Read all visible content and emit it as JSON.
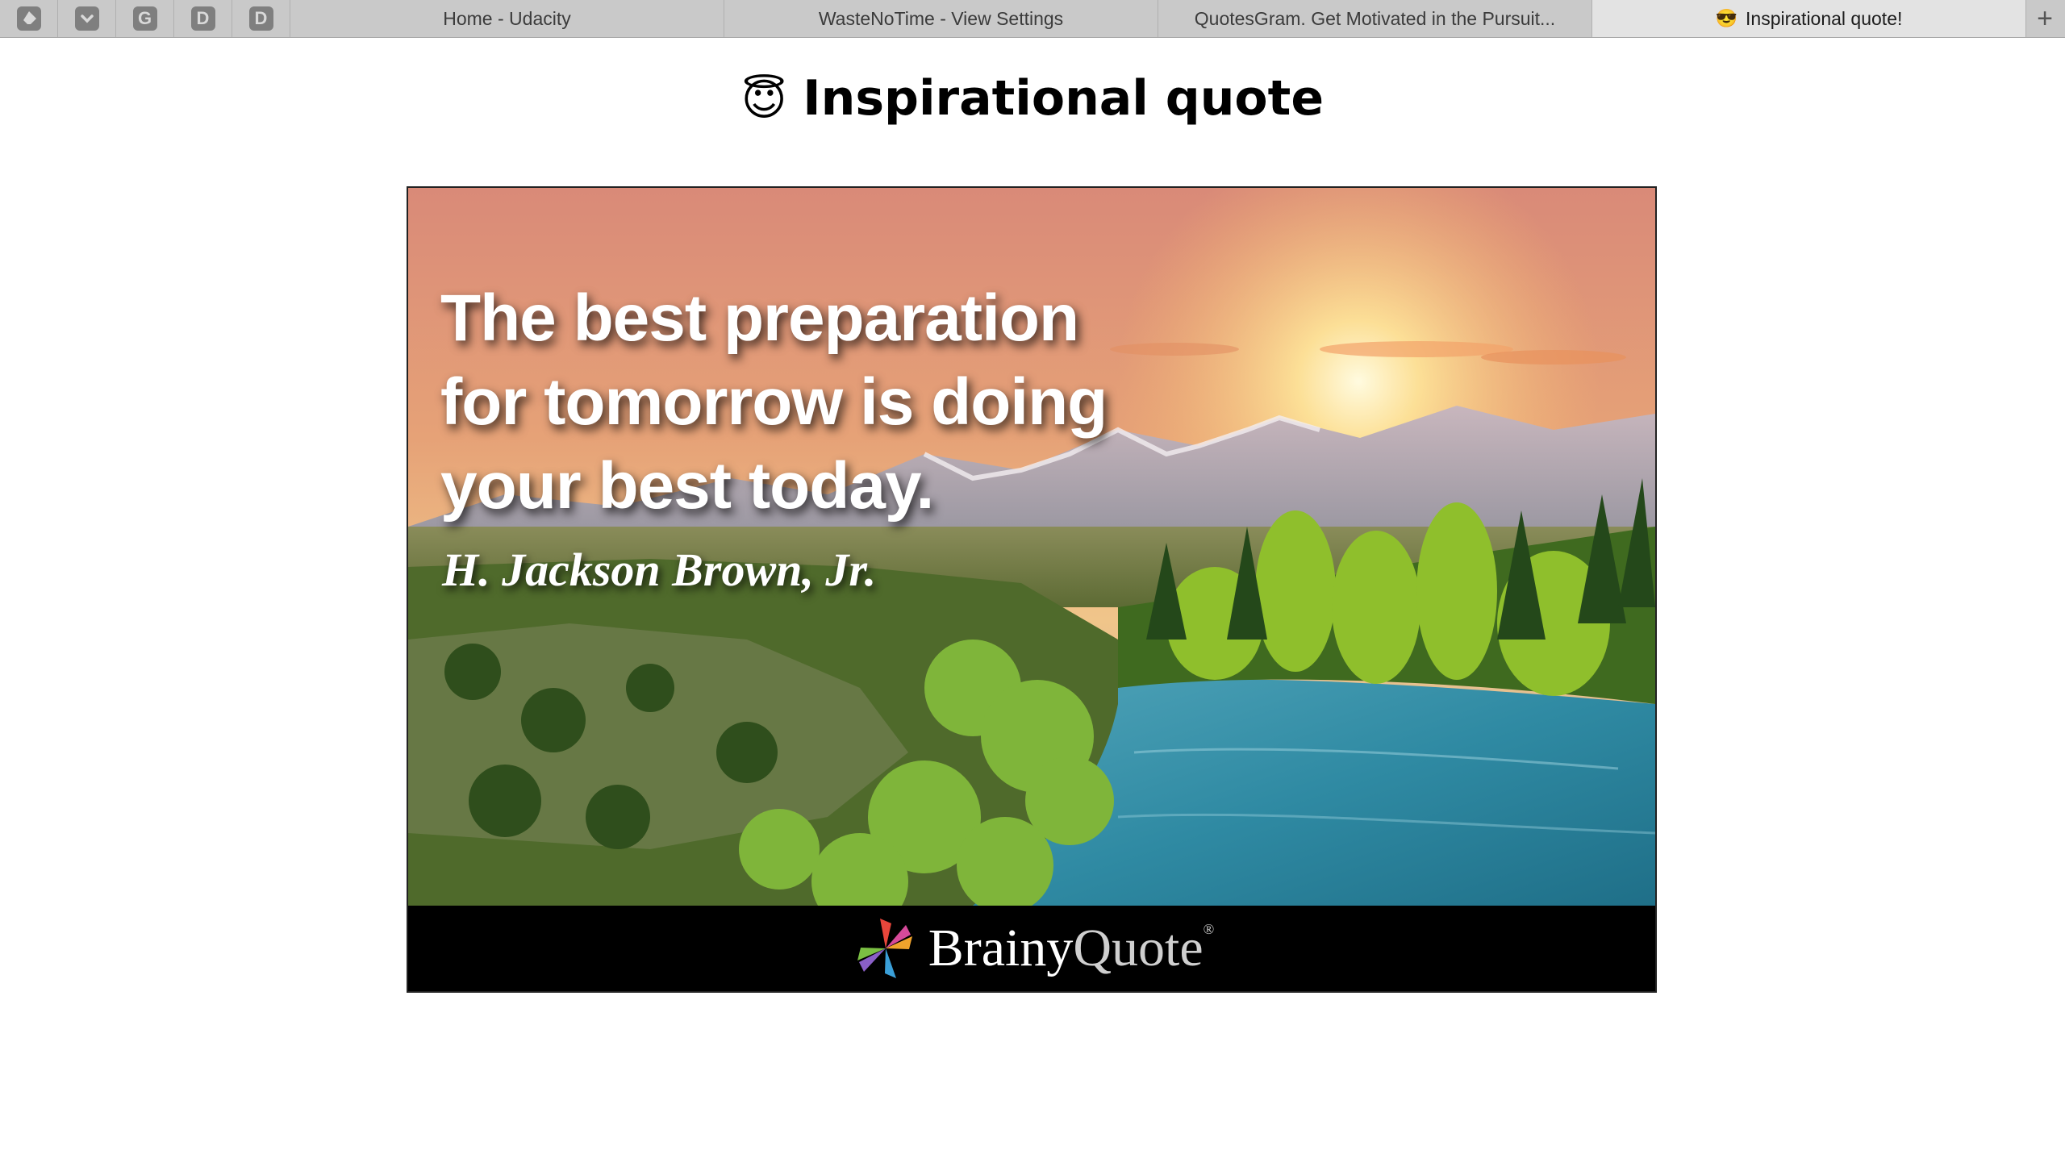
{
  "browser": {
    "pinned_tabs": [
      {
        "icon": "feedly-icon",
        "glyph": "◆"
      },
      {
        "icon": "pocket-icon",
        "glyph": "⌄"
      },
      {
        "icon": "google-icon",
        "glyph": "G"
      },
      {
        "icon": "d-icon",
        "glyph": "D"
      },
      {
        "icon": "d-icon",
        "glyph": "D"
      }
    ],
    "tabs": [
      {
        "label": "Home - Udacity",
        "active": false
      },
      {
        "label": "WasteNoTime - View Settings",
        "active": false
      },
      {
        "label": "QuotesGram. Get Motivated in the Pursuit...",
        "active": false
      },
      {
        "label": "Inspirational quote!",
        "emoji": "😎",
        "active": true
      }
    ],
    "new_tab_label": "+"
  },
  "page": {
    "heading_emoji": "😇",
    "heading": "Inspirational quote",
    "image": {
      "quote_lines": [
        "The best preparation",
        "for tomorrow is doing",
        "your best today."
      ],
      "author": "H. Jackson Brown, Jr.",
      "brand_part1": "Brainy",
      "brand_part2": "Quote",
      "brand_mark": "®"
    }
  },
  "colors": {
    "tabbar": "#c9c9c9",
    "active_tab": "#e3e3e3",
    "page_bg": "#ffffff"
  }
}
